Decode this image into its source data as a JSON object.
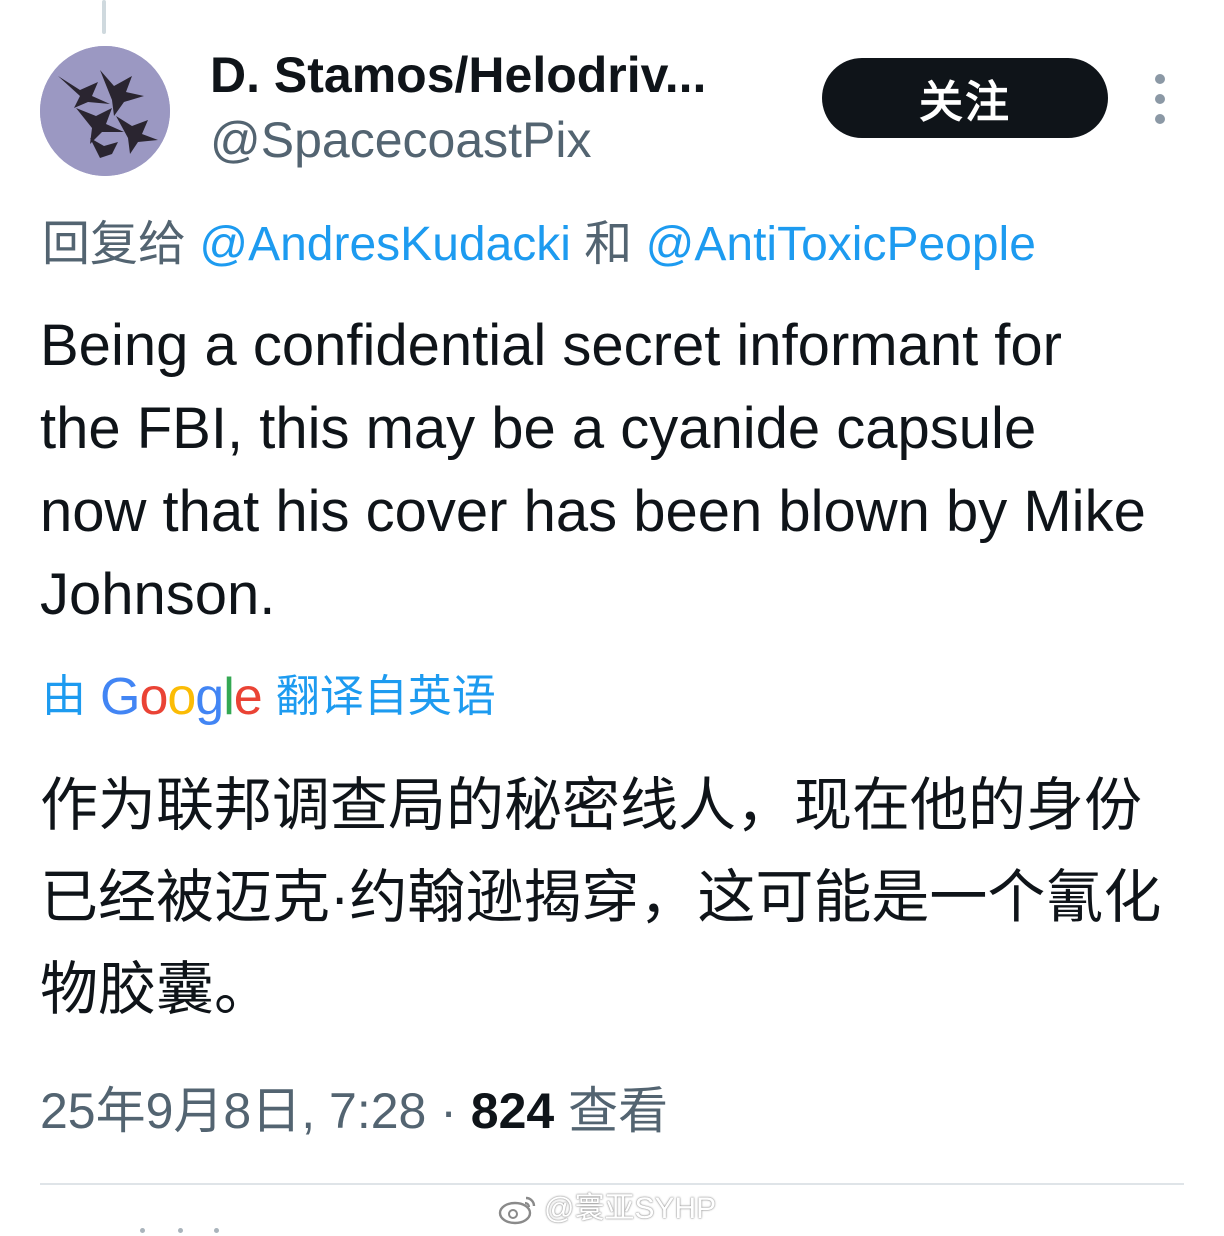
{
  "user": {
    "display_name": "D. Stamos/Helodriv...",
    "handle": "@SpacecoastPix",
    "avatar": "birds-in-sky-avatar"
  },
  "follow_button": {
    "label": "关注"
  },
  "more_icon": "more-vertical-icon",
  "reply_to": {
    "prefix": "回复给",
    "mention_1": "@AndresKudacki",
    "conjunction": "和",
    "mention_2": "@AntiToxicPeople"
  },
  "tweet": {
    "text": "Being a confidential secret informant for the FBI, this may be a cyanide capsule now that his cover has been blown by Mike Johnson."
  },
  "translation": {
    "prefix": "由",
    "logo": [
      "G",
      "o",
      "o",
      "g",
      "l",
      "e"
    ],
    "suffix": "翻译自英语",
    "text": "作为联邦调查局的秘密线人，现在他的身份已经被迈克·约翰逊揭穿，这可能是一个氰化物胶囊。"
  },
  "meta": {
    "date_time": "25年9月8日, 7:28",
    "separator": "·",
    "views_count": "824",
    "views_label": "查看"
  },
  "watermark": {
    "text": "@寰亚SYHP"
  },
  "colors": {
    "accent": "#1d9bf0",
    "text_primary": "#0f1419",
    "text_secondary": "#536471",
    "google_blue": "#4285f4",
    "google_red": "#ea4335",
    "google_yellow": "#fbbc05",
    "google_green": "#34a853"
  }
}
